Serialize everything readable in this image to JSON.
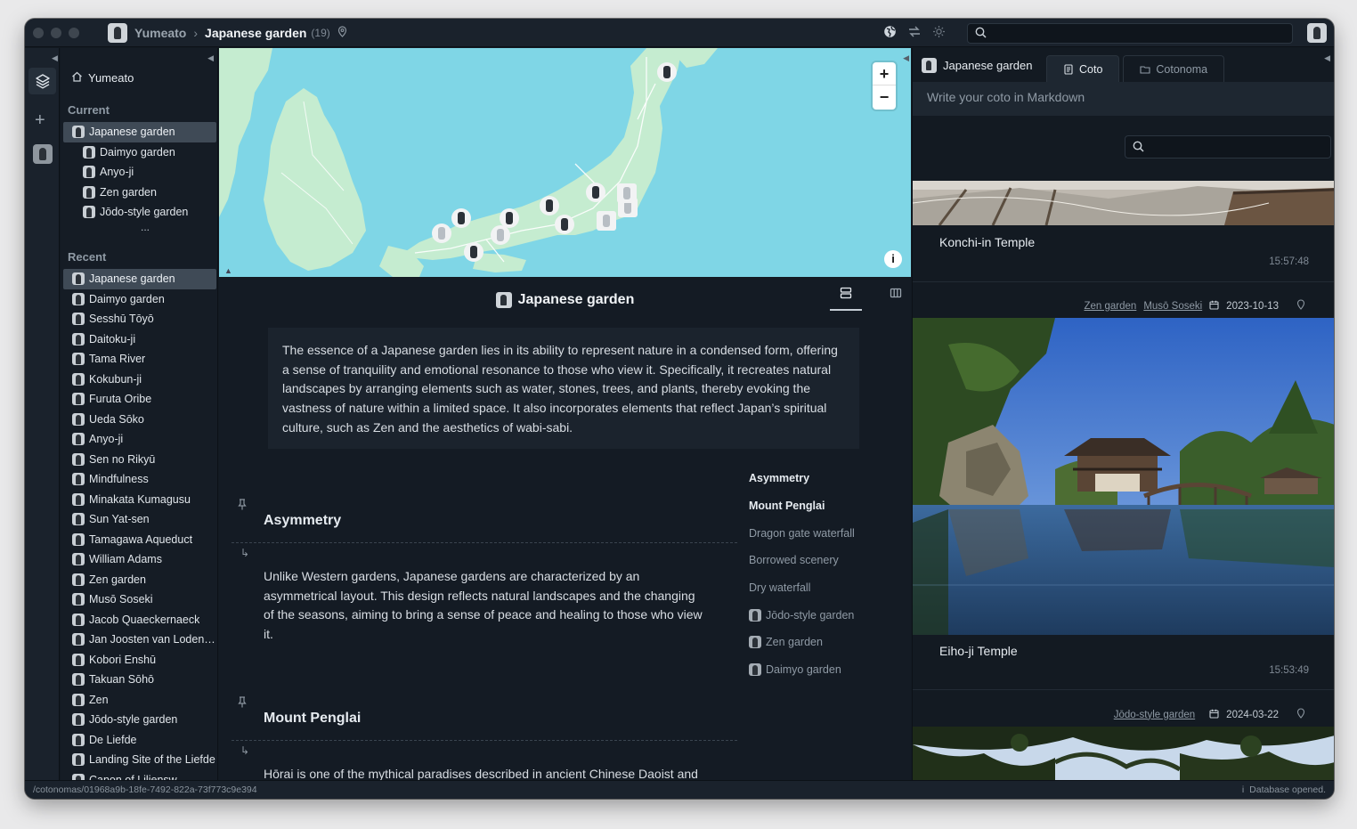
{
  "titlebar": {
    "root": "Yumeato",
    "current": "Japanese garden",
    "count": "(19)",
    "icons": [
      "globe-icon",
      "swap-icon",
      "sun-icon"
    ],
    "search_placeholder": ""
  },
  "sidebar": {
    "home": "Yumeato",
    "current_label": "Current",
    "current_items": [
      {
        "label": "Japanese garden",
        "level": 0,
        "active": true
      },
      {
        "label": "Daimyo garden",
        "level": 1
      },
      {
        "label": "Anyo-ji",
        "level": 1
      },
      {
        "label": "Zen garden",
        "level": 1
      },
      {
        "label": "Jōdo-style garden",
        "level": 1
      }
    ],
    "more": "...",
    "recent_label": "Recent",
    "recent_items": [
      "Japanese garden",
      "Daimyo garden",
      "Sesshū Tōyō",
      "Daitoku-ji",
      "Tama River",
      "Kokubun-ji",
      "Furuta Oribe",
      "Ueda Sōko",
      "Anyo-ji",
      "Sen no Rikyū",
      "Mindfulness",
      "Minakata Kumagusu",
      "Sun Yat-sen",
      "Tamagawa Aqueduct",
      "William Adams",
      "Zen garden",
      "Musō Soseki",
      "Jacob Quaeckernaeck",
      "Jan Joosten van Lodensteijn",
      "Kobori Enshū",
      "Takuan Sōhō",
      "Zen",
      "Jōdo-style garden",
      "De Liefde",
      "Landing Site of the Liefde",
      "Canon of Liliensw..."
    ]
  },
  "map": {
    "zoom_in": "+",
    "zoom_out": "−",
    "info": "i",
    "colors": {
      "water": "#7fd6e6",
      "land": "#c5ecd0",
      "road": "#ffffff"
    }
  },
  "main": {
    "title": "Japanese garden",
    "summary": "The essence of a Japanese garden lies in its ability to represent nature in a condensed form, offering a sense of tranquility and emotional resonance to those who view it. Specifically, it recreates natural landscapes by arranging elements such as water, stones, trees, and plants, thereby evoking the vastness of nature within a limited space. It also incorporates elements that reflect Japan’s spiritual culture, such as Zen and the aesthetics of wabi-sabi.",
    "entries": [
      {
        "title": "Asymmetry",
        "body": "Unlike Western gardens, Japanese gardens are characterized by an asymmetrical layout. This design reflects natural landscapes and the changing of the seasons, aiming to bring a sense of peace and healing to those who view it."
      },
      {
        "title": "Mount Penglai",
        "body": "Hōrai is one of the mythical paradises described in ancient Chinese Daoist and immortalist thought. It was believed to exist far to the east, across the"
      }
    ],
    "toc": [
      {
        "label": "Asymmetry",
        "bold": true,
        "avatar": false
      },
      {
        "label": "Mount Penglai",
        "bold": true,
        "avatar": false
      },
      {
        "label": "Dragon gate waterfall",
        "bold": false,
        "avatar": false
      },
      {
        "label": "Borrowed scenery",
        "bold": false,
        "avatar": false
      },
      {
        "label": "Dry waterfall",
        "bold": false,
        "avatar": false
      },
      {
        "label": "Jōdo-style garden",
        "bold": false,
        "avatar": true
      },
      {
        "label": "Zen garden",
        "bold": false,
        "avatar": true
      },
      {
        "label": "Daimyo garden",
        "bold": false,
        "avatar": true
      }
    ]
  },
  "right": {
    "head": "Japanese garden",
    "tabs": [
      {
        "label": "Coto",
        "active": true
      },
      {
        "label": "Cotonoma",
        "active": false
      }
    ],
    "editor_placeholder": "Write your coto in Markdown",
    "cards": [
      {
        "title": "Konchi-in Temple",
        "time": "15:57:48"
      },
      {
        "title": "Eiho-ji Temple",
        "time": "15:53:49",
        "tags": [
          "Zen garden",
          "Musō Soseki"
        ],
        "date": "2023-10-13"
      },
      {
        "tags": [
          "Jōdo-style garden"
        ],
        "date": "2024-03-22"
      }
    ]
  },
  "status": {
    "path": "/cotonomas/01968a9b-18fe-7492-822a-73f773c9e394",
    "message": "Database opened."
  }
}
